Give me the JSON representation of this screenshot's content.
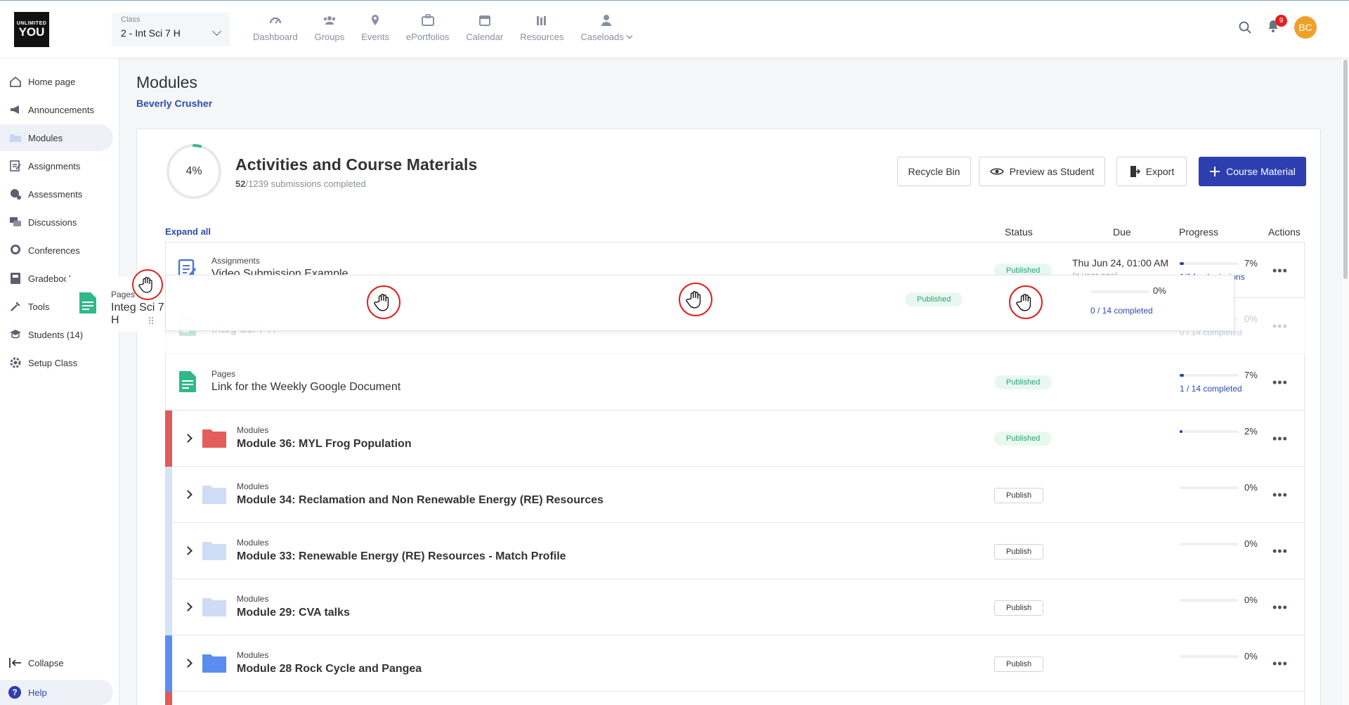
{
  "logo": {
    "line1": "UNLIMITED",
    "line2": "YOU"
  },
  "class_selector": {
    "label": "Class",
    "value": "2 - Int Sci 7 H"
  },
  "nav": [
    {
      "label": "Dashboard",
      "icon": "gauge-icon"
    },
    {
      "label": "Groups",
      "icon": "groups-icon"
    },
    {
      "label": "Events",
      "icon": "location-pin-icon"
    },
    {
      "label": "ePortfolios",
      "icon": "portfolio-icon"
    },
    {
      "label": "Calendar",
      "icon": "calendar-icon"
    },
    {
      "label": "Resources",
      "icon": "library-icon"
    },
    {
      "label": "Caseloads",
      "icon": "person-icon"
    }
  ],
  "header": {
    "notifications_count": "9",
    "avatar_initials": "BC"
  },
  "sidebar": {
    "items": [
      {
        "label": "Home page",
        "icon": "home-icon"
      },
      {
        "label": "Announcements",
        "icon": "megaphone-icon"
      },
      {
        "label": "Modules",
        "icon": "folder-icon"
      },
      {
        "label": "Assignments",
        "icon": "assignment-icon"
      },
      {
        "label": "Assessments",
        "icon": "assessment-icon"
      },
      {
        "label": "Discussions",
        "icon": "discussion-icon"
      },
      {
        "label": "Conferences",
        "icon": "conference-icon"
      },
      {
        "label": "Gradebook",
        "icon": "gradebook-icon"
      },
      {
        "label": "Tools",
        "icon": "tools-icon"
      },
      {
        "label": "Students (14)",
        "icon": "students-icon"
      },
      {
        "label": "Setup Class",
        "icon": "gear-icon"
      }
    ],
    "collapse": "Collapse",
    "help": "Help"
  },
  "page": {
    "title": "Modules",
    "teacher": "Beverly Crusher"
  },
  "activities": {
    "percent": "4%",
    "percent_value": 0.04,
    "title": "Activities and Course Materials",
    "done": "52",
    "total_text": "/1239 submissions completed",
    "buttons": {
      "recycle": "Recycle Bin",
      "preview": "Preview as Student",
      "export": "Export",
      "course_material": "Course Material"
    }
  },
  "table": {
    "expand_all": "Expand all",
    "columns": {
      "status": "Status",
      "due": "Due",
      "progress": "Progress",
      "actions": "Actions"
    },
    "rows": [
      {
        "type": "Assignments",
        "name": "Video Submission Example",
        "status": "Published",
        "due": "Thu Jun 24, 01:00 AM",
        "due_sub": "(a year ago)",
        "progress": "7%",
        "progress_value": 0.07,
        "progress_sub": "1/14 submissions"
      },
      {
        "type": "Pages",
        "name": "Integ Sci 7 H",
        "status": "Published",
        "due": "",
        "due_sub": "",
        "progress": "0%",
        "progress_value": 0,
        "progress_sub": "0 / 14 completed"
      },
      {
        "type": "Pages",
        "name": "Link for the Weekly Google Document",
        "status": "Published",
        "due": "",
        "due_sub": "",
        "progress": "7%",
        "progress_value": 0.07,
        "progress_sub": "1 / 14 completed"
      },
      {
        "type": "Modules",
        "name": "Module 36: MYL Frog Population",
        "status": "Published",
        "due": "",
        "due_sub": "",
        "progress": "2%",
        "progress_value": 0.02,
        "progress_sub": "",
        "stripe": "#e05a5a",
        "folder": "#e55c5c"
      },
      {
        "type": "Modules",
        "name": "Module 34: Reclamation and Non Renewable Energy (RE) Resources",
        "status": "Publish",
        "due": "",
        "due_sub": "",
        "progress": "0%",
        "progress_value": 0,
        "progress_sub": "",
        "stripe": "#d5e2f7",
        "folder": "#cfdcf5"
      },
      {
        "type": "Modules",
        "name": "Module 33: Renewable Energy (RE) Resources - Match Profile",
        "status": "Publish",
        "due": "",
        "due_sub": "",
        "progress": "0%",
        "progress_value": 0,
        "progress_sub": "",
        "stripe": "#d5e2f7",
        "folder": "#cfdcf5"
      },
      {
        "type": "Modules",
        "name": "Module 29: CVA talks",
        "status": "Publish",
        "due": "",
        "due_sub": "",
        "progress": "0%",
        "progress_value": 0,
        "progress_sub": "",
        "stripe": "#d5e2f7",
        "folder": "#cfdcf5"
      },
      {
        "type": "Modules",
        "name": "Module 28 Rock Cycle and Pangea",
        "status": "Publish",
        "due": "",
        "due_sub": "",
        "progress": "0%",
        "progress_value": 0,
        "progress_sub": "",
        "stripe": "#5b8def",
        "folder": "#5b8def"
      }
    ]
  },
  "drag_item": {
    "type": "Pages",
    "name": "Integ Sci 7 H",
    "status": "Published",
    "progress": "0%",
    "progress_sub": "0 / 14 completed"
  },
  "colors": {
    "accent": "#2d3fb0",
    "published_bg": "#e8f8f1",
    "published_text": "#27a37a",
    "notification": "#e02020",
    "avatar": "#f0a02a"
  }
}
